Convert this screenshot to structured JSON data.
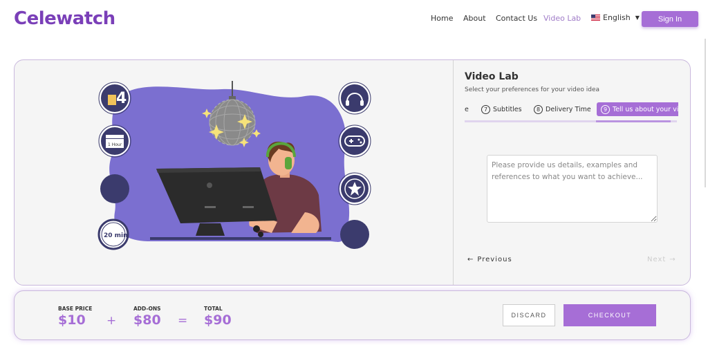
{
  "header": {
    "logo": "Celewatch",
    "nav": {
      "home": "Home",
      "about": "About",
      "contact": "Contact Us",
      "video_lab": "Video Lab"
    },
    "language": "English",
    "sign_in": "Sign In"
  },
  "panel": {
    "title": "Video Lab",
    "subtitle": "Select your preferences for your video idea",
    "tabs": [
      {
        "label": "e",
        "num": ""
      },
      {
        "label": "Subtitles",
        "num": "7"
      },
      {
        "label": "Delivery Time",
        "num": "8"
      },
      {
        "label": "Tell us about your vi",
        "num": "9"
      }
    ],
    "active_tab_index": 3,
    "details_placeholder": "Please provide us details, examples and references to what you want to achieve...",
    "previous": "Previous",
    "next": "Next"
  },
  "illustration": {
    "icons": [
      "number-4-icon",
      "clapperboard-icon",
      "circle-icon",
      "20-min-clock-icon",
      "headphones-icon",
      "gamepad-icon",
      "star-icon",
      "circle-icon"
    ],
    "badges": {
      "clapper_text": "1 Hour",
      "clock_text": "20 min",
      "number": "4"
    }
  },
  "pricing": {
    "base_label": "BASE PRICE",
    "base_value": "$10",
    "addons_label": "ADD-ONS",
    "addons_value": "$80",
    "total_label": "TOTAL",
    "total_value": "$90",
    "plus": "+",
    "equals": "=",
    "discard": "DISCARD",
    "checkout": "CHECKOUT"
  },
  "colors": {
    "accent": "#a66ed6",
    "logo": "#7a3fb8",
    "blob": "#7b6fd0",
    "navy": "#3b3b6d"
  }
}
